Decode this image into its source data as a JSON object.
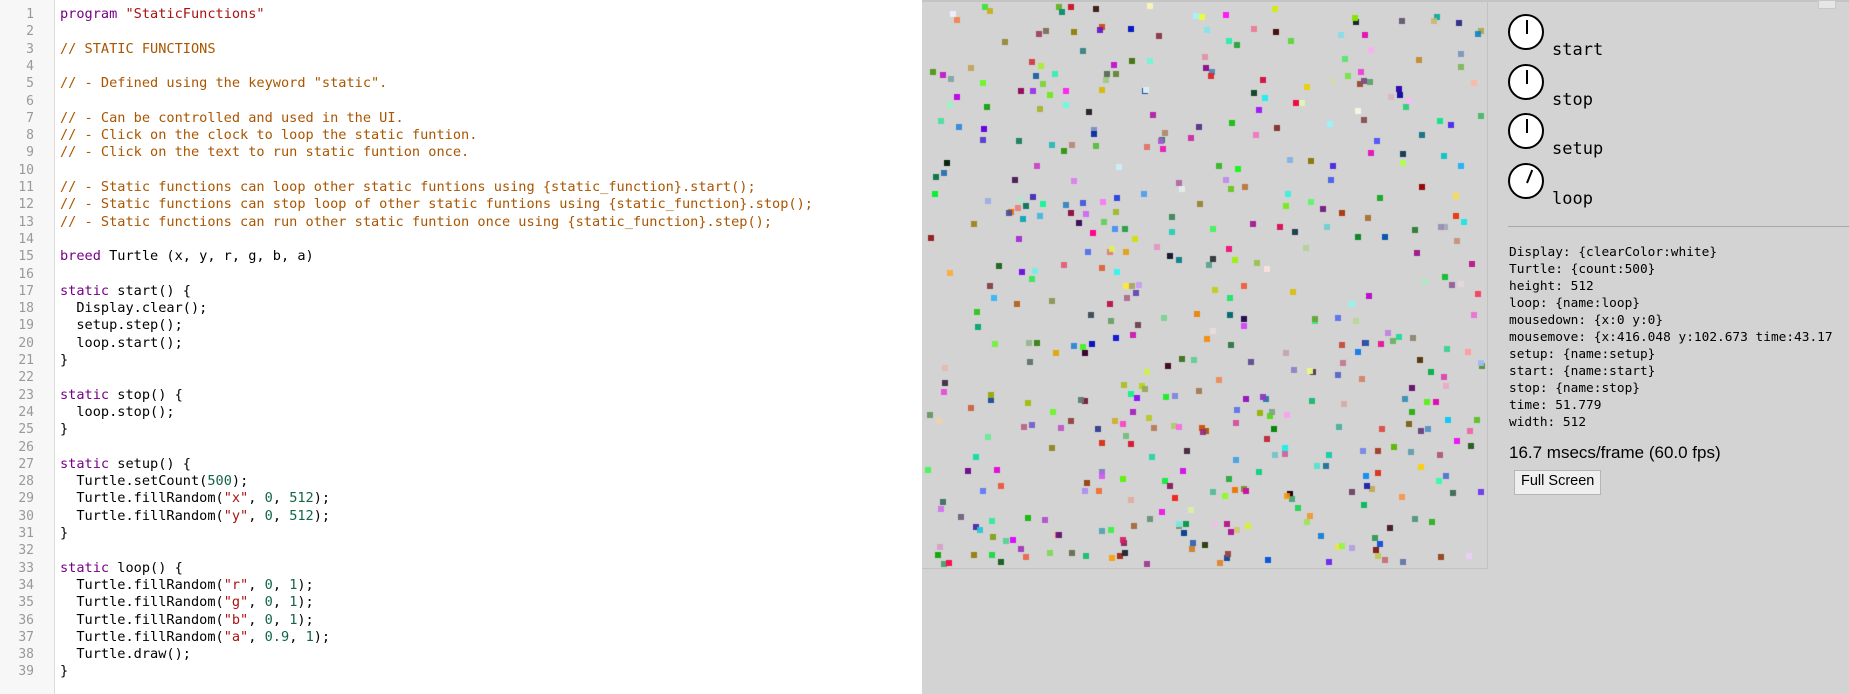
{
  "editor": {
    "lines": [
      [
        [
          "kw",
          "program "
        ],
        [
          "str",
          "\"StaticFunctions\""
        ]
      ],
      [],
      [
        [
          "cmt",
          "// STATIC FUNCTIONS"
        ]
      ],
      [],
      [
        [
          "cmt",
          "// - Defined using the keyword \"static\"."
        ]
      ],
      [],
      [
        [
          "cmt",
          "// - Can be controlled and used in the UI."
        ]
      ],
      [
        [
          "cmt",
          "// - Click on the clock to loop the static funtion."
        ]
      ],
      [
        [
          "cmt",
          "// - Click on the text to run static funtion once."
        ]
      ],
      [],
      [
        [
          "cmt",
          "// - Static functions can loop other static funtions using {static_function}.start();"
        ]
      ],
      [
        [
          "cmt",
          "// - Static functions can stop loop of other static funtions using {static_function}.stop();"
        ]
      ],
      [
        [
          "cmt",
          "// - Static functions can run other static funtion once using {static_function}.step();"
        ]
      ],
      [],
      [
        [
          "kw",
          "breed "
        ],
        [
          "plain",
          "Turtle (x, y, r, g, b, a)"
        ]
      ],
      [],
      [
        [
          "kw",
          "static "
        ],
        [
          "plain",
          "start() {"
        ]
      ],
      [
        [
          "plain",
          "  Display.clear();"
        ]
      ],
      [
        [
          "plain",
          "  setup.step();"
        ]
      ],
      [
        [
          "plain",
          "  loop.start();"
        ]
      ],
      [
        [
          "plain",
          "}"
        ]
      ],
      [],
      [
        [
          "kw",
          "static "
        ],
        [
          "plain",
          "stop() {"
        ]
      ],
      [
        [
          "plain",
          "  loop.stop();"
        ]
      ],
      [
        [
          "plain",
          "}"
        ]
      ],
      [],
      [
        [
          "kw",
          "static "
        ],
        [
          "plain",
          "setup() {"
        ]
      ],
      [
        [
          "plain",
          "  Turtle.setCount("
        ],
        [
          "num",
          "500"
        ],
        [
          "plain",
          ");"
        ]
      ],
      [
        [
          "plain",
          "  Turtle.fillRandom("
        ],
        [
          "str",
          "\"x\""
        ],
        [
          "plain",
          ", "
        ],
        [
          "num",
          "0"
        ],
        [
          "plain",
          ", "
        ],
        [
          "num",
          "512"
        ],
        [
          "plain",
          ");"
        ]
      ],
      [
        [
          "plain",
          "  Turtle.fillRandom("
        ],
        [
          "str",
          "\"y\""
        ],
        [
          "plain",
          ", "
        ],
        [
          "num",
          "0"
        ],
        [
          "plain",
          ", "
        ],
        [
          "num",
          "512"
        ],
        [
          "plain",
          ");"
        ]
      ],
      [
        [
          "plain",
          "}"
        ]
      ],
      [],
      [
        [
          "kw",
          "static "
        ],
        [
          "plain",
          "loop() {"
        ]
      ],
      [
        [
          "plain",
          "  Turtle.fillRandom("
        ],
        [
          "str",
          "\"r\""
        ],
        [
          "plain",
          ", "
        ],
        [
          "num",
          "0"
        ],
        [
          "plain",
          ", "
        ],
        [
          "num",
          "1"
        ],
        [
          "plain",
          ");"
        ]
      ],
      [
        [
          "plain",
          "  Turtle.fillRandom("
        ],
        [
          "str",
          "\"g\""
        ],
        [
          "plain",
          ", "
        ],
        [
          "num",
          "0"
        ],
        [
          "plain",
          ", "
        ],
        [
          "num",
          "1"
        ],
        [
          "plain",
          ");"
        ]
      ],
      [
        [
          "plain",
          "  Turtle.fillRandom("
        ],
        [
          "str",
          "\"b\""
        ],
        [
          "plain",
          ", "
        ],
        [
          "num",
          "0"
        ],
        [
          "plain",
          ", "
        ],
        [
          "num",
          "1"
        ],
        [
          "plain",
          ");"
        ]
      ],
      [
        [
          "plain",
          "  Turtle.fillRandom("
        ],
        [
          "str",
          "\"a\""
        ],
        [
          "plain",
          ", "
        ],
        [
          "num",
          "0.9"
        ],
        [
          "plain",
          ", "
        ],
        [
          "num",
          "1"
        ],
        [
          "plain",
          ");"
        ]
      ],
      [
        [
          "plain",
          "  Turtle.draw();"
        ]
      ],
      [
        [
          "plain",
          "}"
        ]
      ]
    ]
  },
  "simulation": {
    "background": "#d3d3d3",
    "turtle_count": 500,
    "world_width": 512,
    "world_height": 512
  },
  "controls": [
    {
      "id": "start",
      "label": "start",
      "hand_angle_deg": 0
    },
    {
      "id": "stop",
      "label": "stop",
      "hand_angle_deg": 0
    },
    {
      "id": "setup",
      "label": "setup",
      "hand_angle_deg": 0
    },
    {
      "id": "loop",
      "label": "loop",
      "hand_angle_deg": 22
    }
  ],
  "info": [
    "Display: {clearColor:white}",
    "Turtle: {count:500}",
    "height: 512",
    "loop: {name:loop}",
    "mousedown: {x:0 y:0}",
    "mousemove: {x:416.048 y:102.673 time:43.17",
    "setup: {name:setup}",
    "start: {name:start}",
    "stop: {name:stop}",
    "time: 51.779",
    "width: 512"
  ],
  "fps_text": "16.7 msecs/frame (60.0 fps)",
  "fullscreen_label": "Full Screen"
}
